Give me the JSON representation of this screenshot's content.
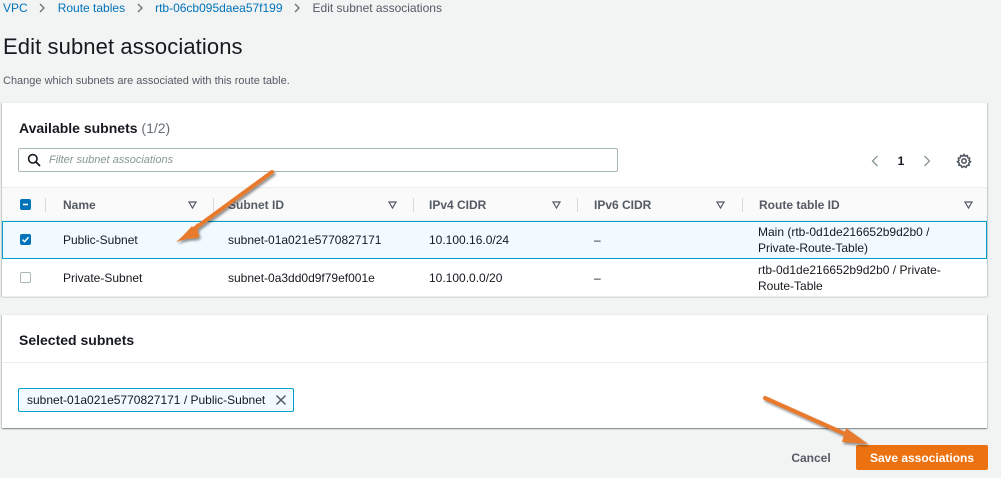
{
  "breadcrumb": {
    "items": [
      "VPC",
      "Route tables",
      "rtb-06cb095daea57f199"
    ],
    "current": "Edit subnet associations"
  },
  "page": {
    "title": "Edit subnet associations",
    "description": "Change which subnets are associated with this route table."
  },
  "available": {
    "heading": "Available subnets",
    "count": "(1/2)",
    "filter_placeholder": "Filter subnet associations",
    "page_number": "1",
    "columns": [
      "Name",
      "Subnet ID",
      "IPv4 CIDR",
      "IPv6 CIDR",
      "Route table ID"
    ],
    "rows": [
      {
        "selected": true,
        "name": "Public-Subnet",
        "subnet_id": "subnet-01a021e5770827171",
        "ipv4": "10.100.16.0/24",
        "ipv6": "–",
        "route_table": "Main (rtb-0d1de216652b9d2b0 / Private-Route-Table)"
      },
      {
        "selected": false,
        "name": "Private-Subnet",
        "subnet_id": "subnet-0a3dd0d9f79ef001e",
        "ipv4": "10.100.0.0/20",
        "ipv6": "–",
        "route_table": "rtb-0d1de216652b9d2b0 / Private-Route-Table"
      }
    ]
  },
  "selected_panel": {
    "heading": "Selected subnets",
    "token": "subnet-01a021e5770827171 / Public-Subnet"
  },
  "actions": {
    "cancel": "Cancel",
    "save": "Save associations"
  },
  "colors": {
    "link": "#0073bb",
    "primary_button": "#ec7211",
    "selection_border": "#00a1c9",
    "annotation_arrow": "#e87a2e"
  },
  "icons": [
    "search-icon",
    "chevron-left-icon",
    "chevron-right-icon",
    "settings-icon",
    "sort-icon",
    "dismiss-icon",
    "checkbox-icon",
    "annotation-arrow"
  ]
}
